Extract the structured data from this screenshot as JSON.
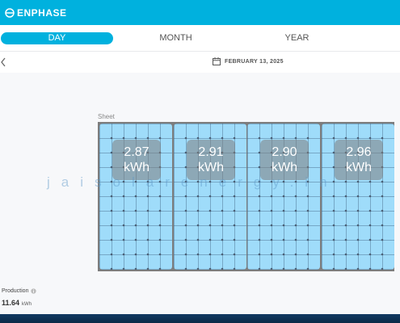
{
  "header": {
    "brand": "ENPHASE",
    "logo_icon": "enphase-logo-icon",
    "color": "#00b1de"
  },
  "tabs": [
    {
      "label": "DAY",
      "active": true
    },
    {
      "label": "MONTH",
      "active": false
    },
    {
      "label": "YEAR",
      "active": false
    }
  ],
  "date_nav": {
    "back_icon": "chevron-left-icon",
    "calendar_icon": "calendar-icon",
    "date": "FEBRUARY 13, 2025"
  },
  "array": {
    "label": "Sheet",
    "panels": [
      {
        "value": "2.87",
        "unit": "kWh"
      },
      {
        "value": "2.91",
        "unit": "kWh"
      },
      {
        "value": "2.90",
        "unit": "kWh"
      },
      {
        "value": "2.96",
        "unit": "kWh"
      }
    ],
    "panel_color": "#9fdcfa"
  },
  "watermark": "jaisolarenergy.in",
  "production": {
    "label": "Production",
    "info_icon": "info-icon",
    "value": "11.64",
    "unit": "kWh"
  }
}
